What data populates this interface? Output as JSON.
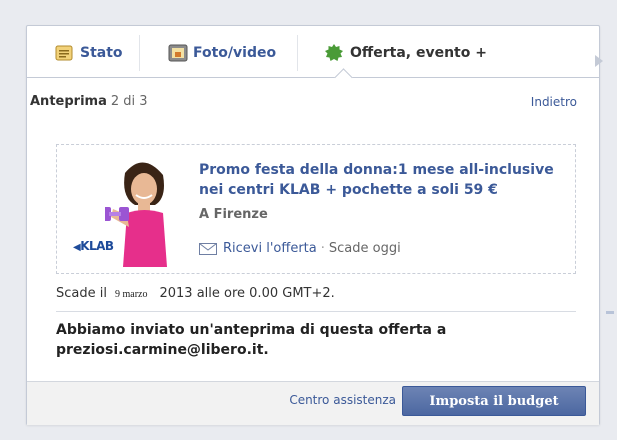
{
  "tabs": [
    {
      "label": "Stato"
    },
    {
      "label": "Foto/video"
    },
    {
      "label": "Offerta, evento +"
    }
  ],
  "preview_header": {
    "title": "Anteprima",
    "counter": "2 di 3",
    "back_label": "Indietro"
  },
  "offer": {
    "title": "Promo festa della donna:1 mese all-inclusive nei centri KLAB + pochette a soli 59 €",
    "location": "A Firenze",
    "claim_label": "Ricevi l'offerta",
    "separator": "·",
    "expires_label": "Scade oggi",
    "brand_logo": "KLAB"
  },
  "expiry": {
    "prefix": "Scade il",
    "date": "9 marzo",
    "suffix": "2013 alle ore 0.00 GMT+2."
  },
  "notice": "Abbiamo inviato un'anteprima di questa offerta a preziosi.carmine@libero.it.",
  "footer": {
    "help_label": "Centro assistenza",
    "budget_button": "Imposta il budget"
  },
  "colors": {
    "link": "#3b5998",
    "button": "#4c67a1",
    "accent_icon": "#4a9b37"
  },
  "icons": {
    "status": "note-icon",
    "photo": "photo-icon",
    "offer": "gear-badge-icon",
    "claim": "envelope-icon"
  }
}
